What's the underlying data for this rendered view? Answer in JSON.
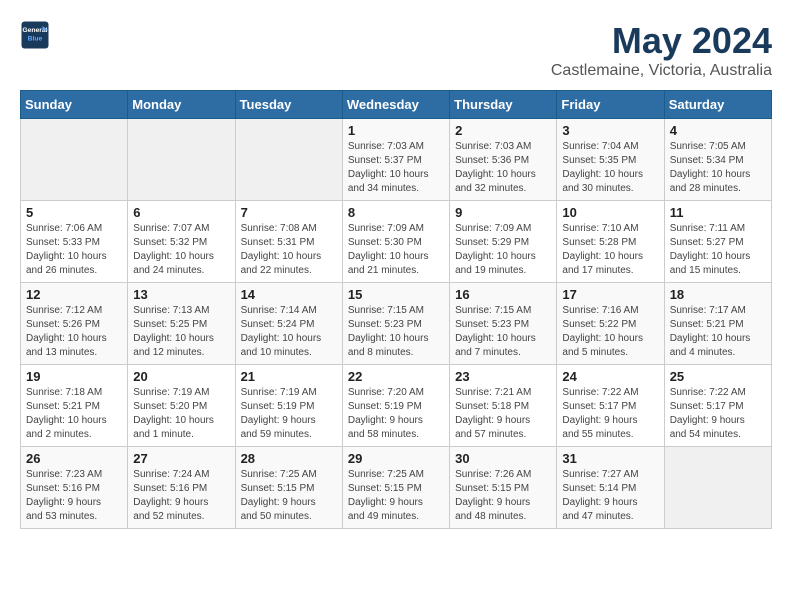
{
  "header": {
    "logo_line1": "General",
    "logo_line2": "Blue",
    "title": "May 2024",
    "subtitle": "Castlemaine, Victoria, Australia"
  },
  "weekdays": [
    "Sunday",
    "Monday",
    "Tuesday",
    "Wednesday",
    "Thursday",
    "Friday",
    "Saturday"
  ],
  "weeks": [
    [
      {
        "day": "",
        "info": ""
      },
      {
        "day": "",
        "info": ""
      },
      {
        "day": "",
        "info": ""
      },
      {
        "day": "1",
        "info": "Sunrise: 7:03 AM\nSunset: 5:37 PM\nDaylight: 10 hours\nand 34 minutes."
      },
      {
        "day": "2",
        "info": "Sunrise: 7:03 AM\nSunset: 5:36 PM\nDaylight: 10 hours\nand 32 minutes."
      },
      {
        "day": "3",
        "info": "Sunrise: 7:04 AM\nSunset: 5:35 PM\nDaylight: 10 hours\nand 30 minutes."
      },
      {
        "day": "4",
        "info": "Sunrise: 7:05 AM\nSunset: 5:34 PM\nDaylight: 10 hours\nand 28 minutes."
      }
    ],
    [
      {
        "day": "5",
        "info": "Sunrise: 7:06 AM\nSunset: 5:33 PM\nDaylight: 10 hours\nand 26 minutes."
      },
      {
        "day": "6",
        "info": "Sunrise: 7:07 AM\nSunset: 5:32 PM\nDaylight: 10 hours\nand 24 minutes."
      },
      {
        "day": "7",
        "info": "Sunrise: 7:08 AM\nSunset: 5:31 PM\nDaylight: 10 hours\nand 22 minutes."
      },
      {
        "day": "8",
        "info": "Sunrise: 7:09 AM\nSunset: 5:30 PM\nDaylight: 10 hours\nand 21 minutes."
      },
      {
        "day": "9",
        "info": "Sunrise: 7:09 AM\nSunset: 5:29 PM\nDaylight: 10 hours\nand 19 minutes."
      },
      {
        "day": "10",
        "info": "Sunrise: 7:10 AM\nSunset: 5:28 PM\nDaylight: 10 hours\nand 17 minutes."
      },
      {
        "day": "11",
        "info": "Sunrise: 7:11 AM\nSunset: 5:27 PM\nDaylight: 10 hours\nand 15 minutes."
      }
    ],
    [
      {
        "day": "12",
        "info": "Sunrise: 7:12 AM\nSunset: 5:26 PM\nDaylight: 10 hours\nand 13 minutes."
      },
      {
        "day": "13",
        "info": "Sunrise: 7:13 AM\nSunset: 5:25 PM\nDaylight: 10 hours\nand 12 minutes."
      },
      {
        "day": "14",
        "info": "Sunrise: 7:14 AM\nSunset: 5:24 PM\nDaylight: 10 hours\nand 10 minutes."
      },
      {
        "day": "15",
        "info": "Sunrise: 7:15 AM\nSunset: 5:23 PM\nDaylight: 10 hours\nand 8 minutes."
      },
      {
        "day": "16",
        "info": "Sunrise: 7:15 AM\nSunset: 5:23 PM\nDaylight: 10 hours\nand 7 minutes."
      },
      {
        "day": "17",
        "info": "Sunrise: 7:16 AM\nSunset: 5:22 PM\nDaylight: 10 hours\nand 5 minutes."
      },
      {
        "day": "18",
        "info": "Sunrise: 7:17 AM\nSunset: 5:21 PM\nDaylight: 10 hours\nand 4 minutes."
      }
    ],
    [
      {
        "day": "19",
        "info": "Sunrise: 7:18 AM\nSunset: 5:21 PM\nDaylight: 10 hours\nand 2 minutes."
      },
      {
        "day": "20",
        "info": "Sunrise: 7:19 AM\nSunset: 5:20 PM\nDaylight: 10 hours\nand 1 minute."
      },
      {
        "day": "21",
        "info": "Sunrise: 7:19 AM\nSunset: 5:19 PM\nDaylight: 9 hours\nand 59 minutes."
      },
      {
        "day": "22",
        "info": "Sunrise: 7:20 AM\nSunset: 5:19 PM\nDaylight: 9 hours\nand 58 minutes."
      },
      {
        "day": "23",
        "info": "Sunrise: 7:21 AM\nSunset: 5:18 PM\nDaylight: 9 hours\nand 57 minutes."
      },
      {
        "day": "24",
        "info": "Sunrise: 7:22 AM\nSunset: 5:17 PM\nDaylight: 9 hours\nand 55 minutes."
      },
      {
        "day": "25",
        "info": "Sunrise: 7:22 AM\nSunset: 5:17 PM\nDaylight: 9 hours\nand 54 minutes."
      }
    ],
    [
      {
        "day": "26",
        "info": "Sunrise: 7:23 AM\nSunset: 5:16 PM\nDaylight: 9 hours\nand 53 minutes."
      },
      {
        "day": "27",
        "info": "Sunrise: 7:24 AM\nSunset: 5:16 PM\nDaylight: 9 hours\nand 52 minutes."
      },
      {
        "day": "28",
        "info": "Sunrise: 7:25 AM\nSunset: 5:15 PM\nDaylight: 9 hours\nand 50 minutes."
      },
      {
        "day": "29",
        "info": "Sunrise: 7:25 AM\nSunset: 5:15 PM\nDaylight: 9 hours\nand 49 minutes."
      },
      {
        "day": "30",
        "info": "Sunrise: 7:26 AM\nSunset: 5:15 PM\nDaylight: 9 hours\nand 48 minutes."
      },
      {
        "day": "31",
        "info": "Sunrise: 7:27 AM\nSunset: 5:14 PM\nDaylight: 9 hours\nand 47 minutes."
      },
      {
        "day": "",
        "info": ""
      }
    ]
  ]
}
